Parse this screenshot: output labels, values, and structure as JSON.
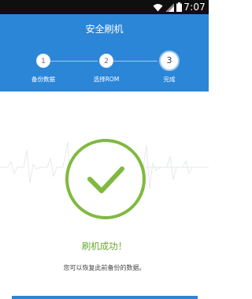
{
  "status_bar": {
    "time": "7:07",
    "icons": [
      "wifi-icon",
      "signal-icon",
      "battery-icon"
    ]
  },
  "header": {
    "title": "安全刷机",
    "background": "#2b86d8"
  },
  "steps": [
    {
      "number": "1",
      "label": "备份数据",
      "state": "done"
    },
    {
      "number": "2",
      "label": "选择ROM",
      "state": "done"
    },
    {
      "number": "3",
      "label": "完成",
      "state": "current"
    }
  ],
  "result": {
    "icon": "checkmark-icon",
    "title": "刷机成功！",
    "description": "您可以恢复此前备份的数据。",
    "accent": "#80b940"
  }
}
